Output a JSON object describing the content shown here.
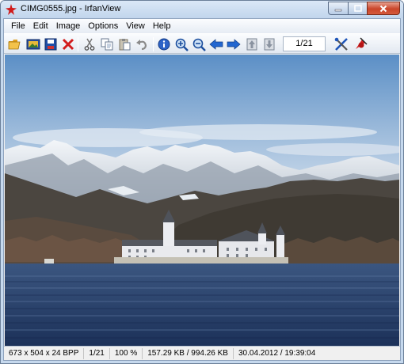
{
  "window": {
    "title": "CIMG0555.jpg - IrfanView"
  },
  "menu": {
    "items": [
      {
        "id": "file",
        "label": "File"
      },
      {
        "id": "edit",
        "label": "Edit"
      },
      {
        "id": "image",
        "label": "Image"
      },
      {
        "id": "options",
        "label": "Options"
      },
      {
        "id": "view",
        "label": "View"
      },
      {
        "id": "help",
        "label": "Help"
      }
    ]
  },
  "toolbar": {
    "page_counter": "1/21",
    "icons": [
      "open-folder-icon",
      "slideshow-icon",
      "save-icon",
      "delete-icon",
      "cut-icon",
      "copy-icon",
      "paste-icon",
      "undo-icon",
      "info-icon",
      "zoom-in-icon",
      "zoom-out-icon",
      "previous-arrow-icon",
      "next-arrow-icon",
      "first-page-icon",
      "last-page-icon",
      "settings-tools-icon",
      "exit-icon"
    ]
  },
  "image": {
    "description_alt": "Lake with castle and snowy mountains",
    "colors": {
      "sky_top": "#5b8fc6",
      "sky_bottom": "#c9d9ea",
      "water": "#27406a",
      "mountain_snow": "#e6ebf1",
      "forest": "#3f3a33"
    }
  },
  "status": {
    "dimensions": "673 x 504 x 24 BPP",
    "index": "1/21",
    "zoom": "100 %",
    "size": "157.29 KB / 994.26 KB",
    "datetime": "30.04.2012 / 19:39:04"
  }
}
